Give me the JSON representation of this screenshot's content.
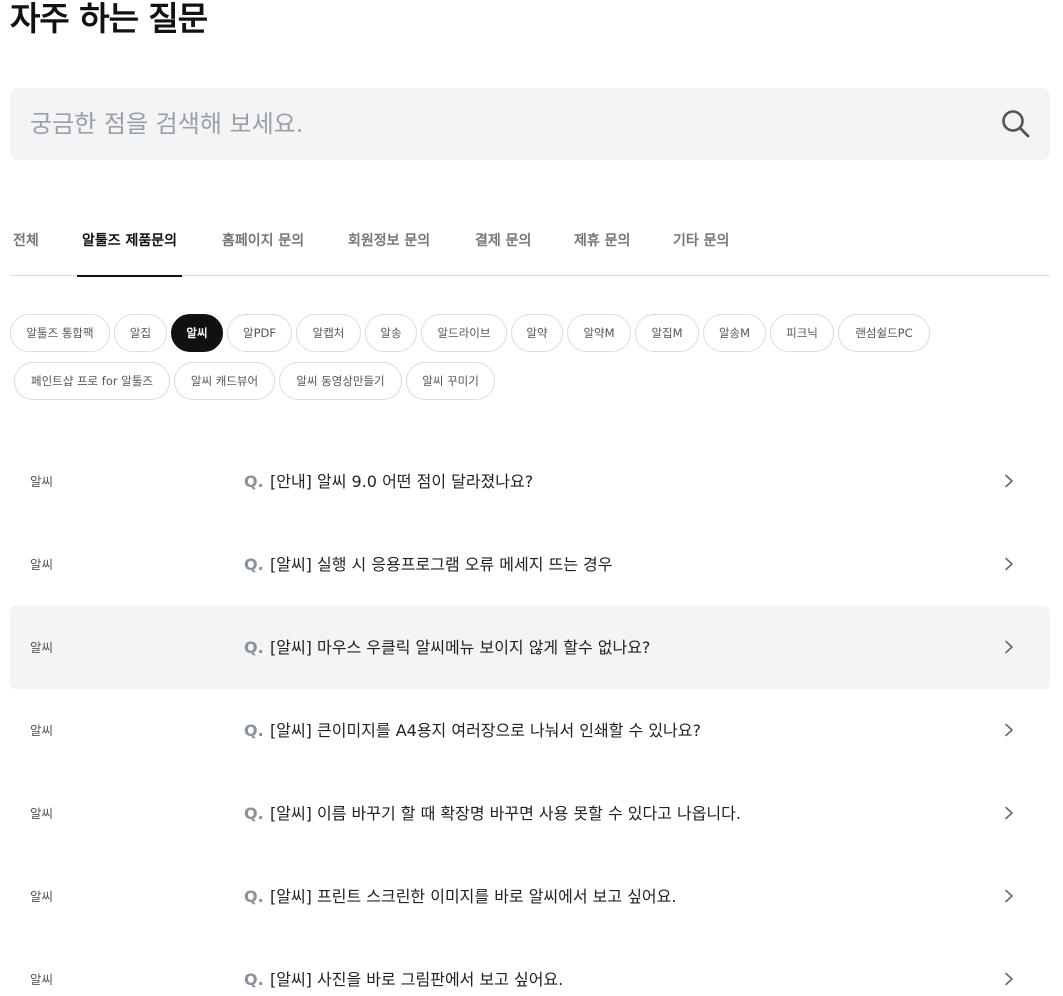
{
  "page": {
    "title": "자주 하는 질문"
  },
  "search": {
    "placeholder": "궁금한 점을 검색해 보세요.",
    "icon": "search-icon"
  },
  "tabs": [
    {
      "label": "전체",
      "active": false
    },
    {
      "label": "알툴즈 제품문의",
      "active": true
    },
    {
      "label": "홈페이지 문의",
      "active": false
    },
    {
      "label": "회원정보 문의",
      "active": false
    },
    {
      "label": "결제 문의",
      "active": false
    },
    {
      "label": "제휴 문의",
      "active": false
    },
    {
      "label": "기타 문의",
      "active": false
    }
  ],
  "chips": [
    {
      "label": "알툴즈 통합팩",
      "active": false
    },
    {
      "label": "알집",
      "active": false
    },
    {
      "label": "알씨",
      "active": true
    },
    {
      "label": "알PDF",
      "active": false
    },
    {
      "label": "알캡처",
      "active": false
    },
    {
      "label": "알송",
      "active": false
    },
    {
      "label": "알드라이브",
      "active": false
    },
    {
      "label": "알약",
      "active": false
    },
    {
      "label": "알약M",
      "active": false
    },
    {
      "label": "알집M",
      "active": false
    },
    {
      "label": "알송M",
      "active": false
    },
    {
      "label": "피크닉",
      "active": false
    },
    {
      "label": "랜섬쉴드PC",
      "active": false
    },
    {
      "label": "페인트샵 프로 for 알툴즈",
      "active": false
    },
    {
      "label": "알씨 캐드뷰어",
      "active": false
    },
    {
      "label": "알씨 동영상만들기",
      "active": false
    },
    {
      "label": "알씨 꾸미기",
      "active": false
    }
  ],
  "faq": {
    "q_prefix": "Q.",
    "items": [
      {
        "category": "알씨",
        "question": "[안내] 알씨 9.0 어떤 점이 달라졌나요?"
      },
      {
        "category": "알씨",
        "question": "[알씨] 실행 시 응용프로그램 오류 메세지 뜨는 경우"
      },
      {
        "category": "알씨",
        "question": "[알씨] 마우스 우클릭 알씨메뉴 보이지 않게 할수 없나요?",
        "highlighted": true
      },
      {
        "category": "알씨",
        "question": "[알씨] 큰이미지를 A4용지 여러장으로 나눠서 인쇄할 수 있나요?"
      },
      {
        "category": "알씨",
        "question": "[알씨] 이름 바꾸기 할 때 확장명 바꾸면 사용 못할 수 있다고 나옵니다."
      },
      {
        "category": "알씨",
        "question": "[알씨] 프린트 스크린한 이미지를 바로 알씨에서 보고 싶어요."
      },
      {
        "category": "알씨",
        "question": "[알씨] 사진을 바로 그림판에서 보고 싶어요."
      }
    ]
  },
  "colors": {
    "text": "#111111",
    "muted": "#8a929c",
    "surface": "#f3f4f6",
    "border": "#dcdcdc"
  }
}
